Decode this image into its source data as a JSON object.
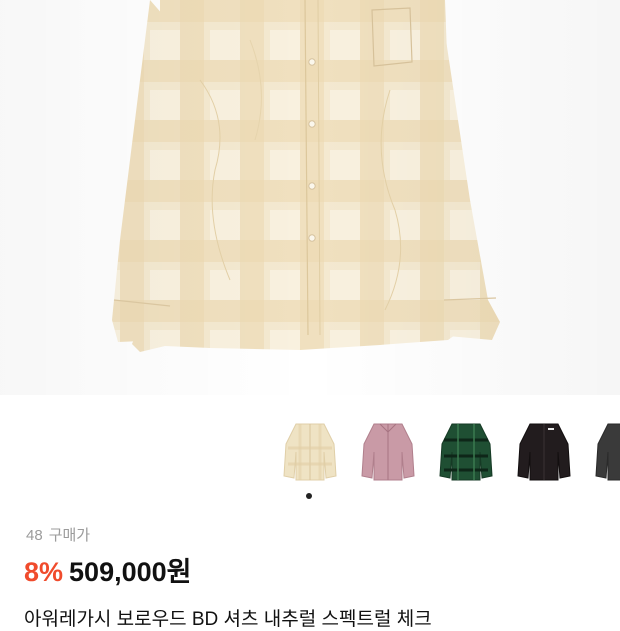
{
  "product": {
    "purchase_count": "48",
    "purchase_label": "구매가",
    "discount": "8%",
    "price": "509,000원",
    "title": "아워레가시 보로우드 BD 셔츠 내추럴 스펙트럴 체크"
  },
  "gallery": {
    "active_index": 0,
    "thumbnails": [
      {
        "name": "natural-check-shirt",
        "color": "#efe3c4"
      },
      {
        "name": "pink-shirt",
        "color": "#c99aa6"
      },
      {
        "name": "green-check-shirt",
        "color": "#1f4f33"
      },
      {
        "name": "black-shirt",
        "color": "#221c1e"
      },
      {
        "name": "charcoal-shirt",
        "color": "#3a3a3a"
      }
    ]
  },
  "colors": {
    "discount": "#f04b2c",
    "price": "#111111",
    "meta": "#9b9b9b",
    "shirt_base": "#f3e7cc",
    "shirt_check": "#e8d4a8"
  }
}
